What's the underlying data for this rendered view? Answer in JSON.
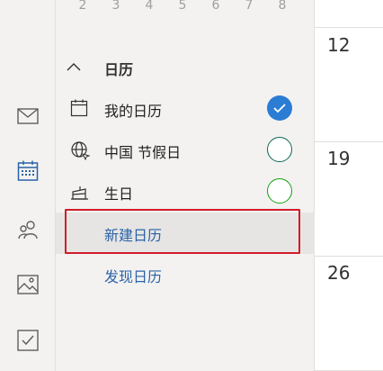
{
  "mini_calendar": {
    "days": [
      "2",
      "3",
      "4",
      "5",
      "6",
      "7",
      "8"
    ]
  },
  "rail": {
    "items": [
      {
        "name": "mail-icon"
      },
      {
        "name": "calendar-icon",
        "active": true
      },
      {
        "name": "people-icon"
      },
      {
        "name": "photos-icon"
      },
      {
        "name": "todo-icon"
      }
    ],
    "accent": "#2b63a8"
  },
  "calendars_section": {
    "title": "日历",
    "items": [
      {
        "label": "我的日历",
        "icon": "calendar-icon",
        "checked": true,
        "color": "#2b7cd3"
      },
      {
        "label": "中国 节假日",
        "icon": "globe-icon",
        "checked": false,
        "color": "#0b6a53"
      },
      {
        "label": "生日",
        "icon": "birthday-cake-icon",
        "checked": false,
        "color": "#13a10e"
      }
    ]
  },
  "actions": {
    "new_calendar": "新建日历",
    "discover_calendars": "发现日历"
  },
  "grid": {
    "dates": [
      "12",
      "19",
      "26"
    ]
  },
  "colors": {
    "focus_outline": "#d01d2a",
    "link": "#2b63a8"
  }
}
